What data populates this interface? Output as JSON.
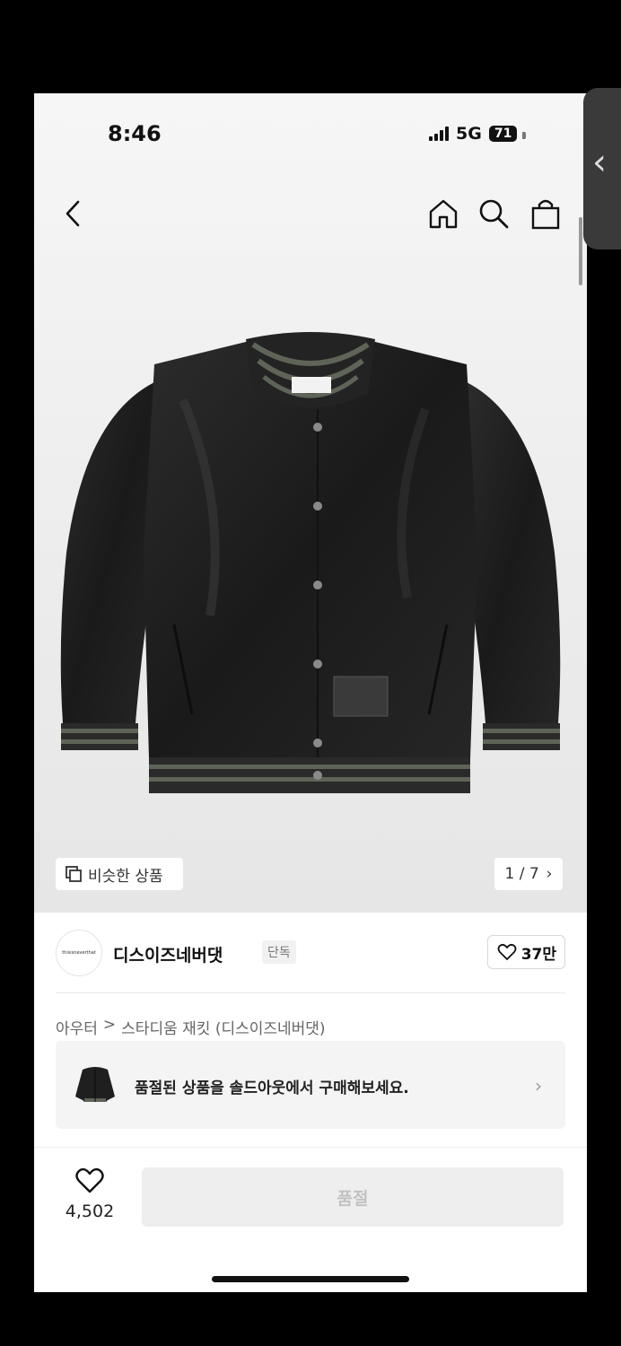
{
  "status_bar": {
    "time": "8:46",
    "network": "5G",
    "battery": "71"
  },
  "header": {
    "back_icon": "chevron-left-icon",
    "home_icon": "home-icon",
    "search_icon": "search-icon",
    "cart_icon": "bag-icon"
  },
  "hero": {
    "product_image": "black-stadium-jacket",
    "similar_label": "비슷한 상품",
    "page_counter": "1 / 7"
  },
  "brand": {
    "name": "디스이즈네버댓",
    "tag": "단독",
    "likes": "37만",
    "logo_text": "thisisneverthat"
  },
  "breadcrumb": {
    "category": "아우터",
    "separator": ">",
    "product": "스타디움 재킷 (디스이즈네버댓)"
  },
  "banner": {
    "text": "품절된 상품을 솔드아웃에서 구매해보세요."
  },
  "bottom": {
    "wish_count": "4,502",
    "buy_label": "품절"
  },
  "colors": {
    "accent": "#111111",
    "soldout_bg": "#eeeeee"
  }
}
